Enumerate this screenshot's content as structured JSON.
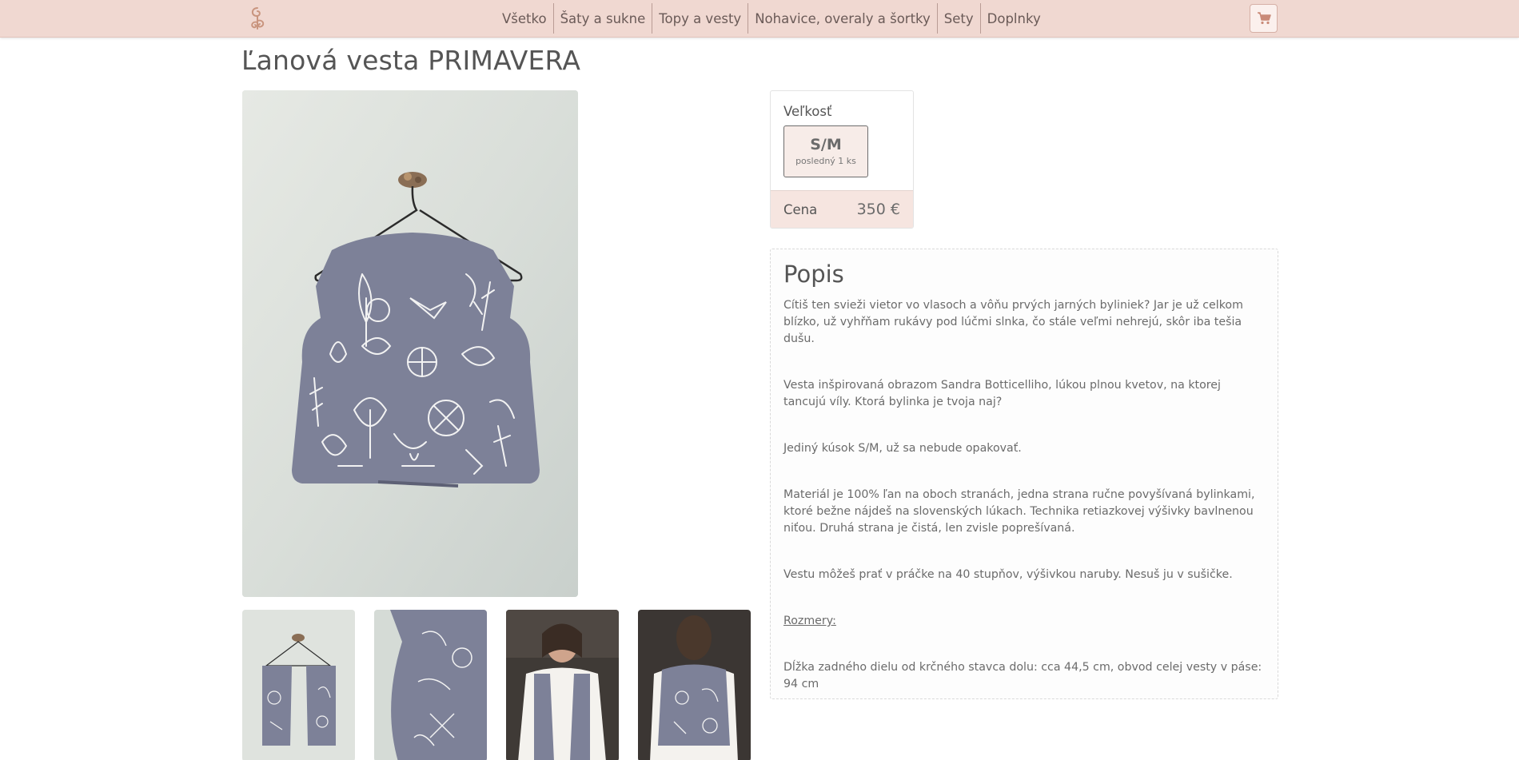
{
  "header": {
    "logo_icon": "swirl-logo-icon",
    "nav": [
      {
        "label": "Všetko"
      },
      {
        "label": "Šaty a sukne"
      },
      {
        "label": "Topy a vesty"
      },
      {
        "label": "Nohavice, overaly a šortky"
      },
      {
        "label": "Sety"
      },
      {
        "label": "Doplnky"
      }
    ],
    "cart_icon": "shopping-cart-icon"
  },
  "product": {
    "title": "Ľanová vesta PRIMAVERA",
    "size_label": "Veľkosť",
    "sizes": [
      {
        "name": "S/M",
        "stock": "posledný 1 ks"
      }
    ],
    "price_label": "Cena",
    "price": "350 €"
  },
  "description": {
    "title": "Popis",
    "paragraphs": [
      "Cítiš ten svieži vietor vo vlasoch a vôňu prvých jarných byliniek? Jar je už celkom blízko, už vyhřňam rukávy pod lúčmi slnka, čo stále veľmi nehrejú, skôr iba tešia dušu.",
      "Vesta inšpirovaná obrazom Sandra Botticelliho, lúkou plnou kvetov, na ktorej tancujú víly. Ktorá bylinka je tvoja naj?",
      "Jediný kúsok S/M, už sa nebude opakovať.",
      "Materiál je 100% ľan na oboch stranách, jedna strana ručne povyšívaná bylinkami, ktoré bežne nájdeš na slovenských lúkach. Technika retiazkovej výšivky bavlnenou niťou. Druhá strana je čistá, len zvisle poprešívaná.",
      "Vestu môžeš prať v práčke na 40 stupňov, výšivkou naruby. Nesuš ju v sušičke.",
      "Rozmery:",
      "Dĺžka zadného dielu od krčného stavca dolu: cca 44,5 cm, obvod celej vesty v páse: 94 cm"
    ]
  },
  "colors": {
    "header_bg": "#f0d8d1",
    "price_bg": "#f6e5e0",
    "vest": "#7d8198"
  }
}
